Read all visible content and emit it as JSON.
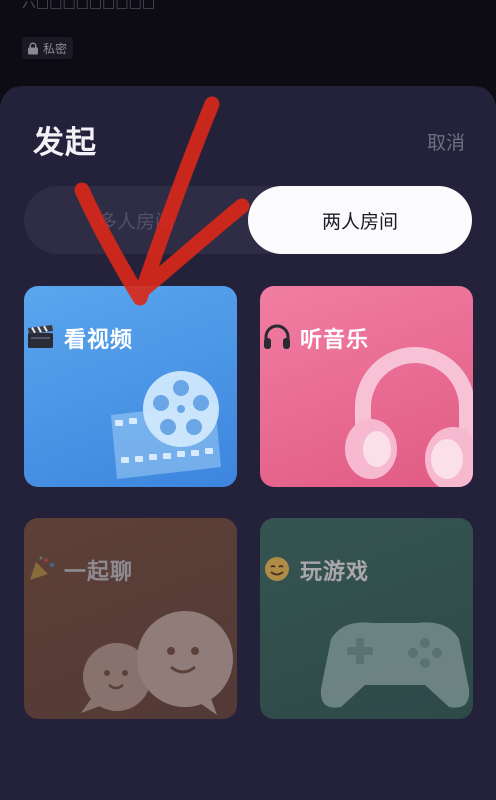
{
  "background_page": {
    "top_text": "六□□□□□□□□□",
    "private_badge": "私密"
  },
  "sheet": {
    "title": "发起",
    "cancel_label": "取消",
    "tabs": [
      {
        "label": "多人房间",
        "selected": false
      },
      {
        "label": "两人房间",
        "selected": true
      }
    ],
    "cards": [
      {
        "label": "看视频",
        "icon": "clapperboard-icon",
        "color": "#4d98ea"
      },
      {
        "label": "听音乐",
        "icon": "headphones-icon",
        "color": "#ea6c94"
      },
      {
        "label": "一起聊",
        "icon": "party-popper-icon",
        "color": "#8c5a37"
      },
      {
        "label": "玩游戏",
        "icon": "smiling-face-icon",
        "color": "#3d6a5b"
      }
    ]
  },
  "annotation": {
    "shape": "checkmark",
    "color": "#d8281a"
  }
}
